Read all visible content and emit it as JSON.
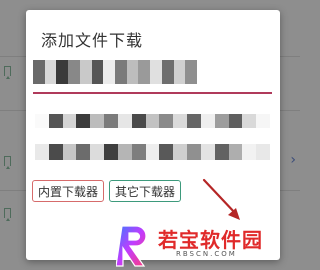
{
  "dialog": {
    "title": "添加文件下载",
    "url_field_value": "",
    "buttons": {
      "builtin_downloader": "内置下载器",
      "other_downloader": "其它下载器"
    }
  },
  "background": {
    "chevron_icon": "chevron-right-icon",
    "bookmark_icon": "bookmark-icon"
  },
  "watermark": {
    "text": "若宝软件园",
    "subtext": "RBSCN.COM"
  },
  "colors": {
    "accent_underline": "#b03a5b",
    "builtin_border": "#d66b6b",
    "other_border": "#3d9a7c",
    "arrow": "#b52626",
    "watermark": "#e02a2a"
  }
}
